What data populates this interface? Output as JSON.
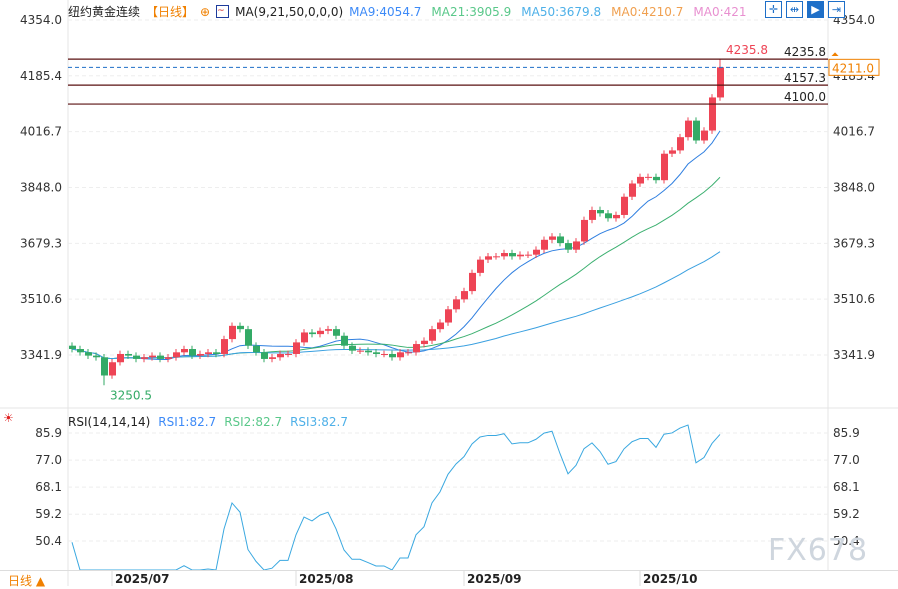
{
  "header": {
    "title": "纽约黄金连续",
    "period_tag": "【日线】",
    "ma_label": "MA(9,21,50,0,0,0)",
    "ma": [
      {
        "label": "MA9:4054.7",
        "color": "#3d8af7"
      },
      {
        "label": "MA21:3905.9",
        "color": "#5ac88a"
      },
      {
        "label": "MA50:3679.8",
        "color": "#4eb0e8"
      },
      {
        "label": "MA0:4210.7",
        "color": "#f0a050"
      },
      {
        "label": "MA0:421",
        "color": "#e890d0"
      }
    ]
  },
  "toolbar": [
    {
      "icon": "crosshair-icon",
      "glyph": "✛"
    },
    {
      "icon": "fit-range-icon",
      "glyph": "⇹"
    },
    {
      "icon": "play-forward-icon",
      "glyph": "▶"
    },
    {
      "icon": "jump-end-icon",
      "glyph": "⇥"
    }
  ],
  "price_axis": {
    "min": 3341.9,
    "max": 4354.0,
    "ticks": [
      "4354.0",
      "4185.4",
      "4016.7",
      "3848.0",
      "3679.3",
      "3510.6",
      "3341.9"
    ]
  },
  "levels": [
    {
      "value": 4235.8,
      "label": "4235.8"
    },
    {
      "value": 4157.3,
      "label": "4157.3"
    },
    {
      "value": 4100.0,
      "label": "4100.0"
    }
  ],
  "current_price": {
    "value": 4211.0,
    "label": "4211.0"
  },
  "high_marker": {
    "value": 4235.8,
    "label": "4235.8"
  },
  "low_marker": {
    "value": 3250.5,
    "label": "3250.5"
  },
  "colors": {
    "up": "#ee4455",
    "down": "#33aa66",
    "level": "#5a1010",
    "current": "#1e6fc8",
    "current_box": "#f08000"
  },
  "closes": [
    3360,
    3350,
    3340,
    3335,
    3280,
    3320,
    3345,
    3340,
    3330,
    3335,
    3340,
    3330,
    3335,
    3350,
    3360,
    3340,
    3345,
    3350,
    3345,
    3390,
    3430,
    3420,
    3370,
    3350,
    3330,
    3335,
    3345,
    3345,
    3380,
    3410,
    3405,
    3415,
    3420,
    3400,
    3370,
    3355,
    3355,
    3350,
    3345,
    3345,
    3335,
    3350,
    3350,
    3375,
    3385,
    3420,
    3440,
    3480,
    3510,
    3535,
    3590,
    3630,
    3640,
    3640,
    3650,
    3640,
    3645,
    3645,
    3660,
    3690,
    3700,
    3680,
    3660,
    3685,
    3750,
    3780,
    3770,
    3755,
    3765,
    3820,
    3860,
    3880,
    3880,
    3870,
    3950,
    3960,
    4000,
    4050,
    3990,
    4020,
    4120,
    4211
  ],
  "dates": [
    {
      "label": "2025/07",
      "index": 5
    },
    {
      "label": "2025/08",
      "index": 28
    },
    {
      "label": "2025/09",
      "index": 49
    },
    {
      "label": "2025/10",
      "index": 71
    }
  ],
  "rsi": {
    "header": "RSI(14,14,14)",
    "items": [
      {
        "label": "RSI1:82.7",
        "color": "#3d8af7"
      },
      {
        "label": "RSI2:82.7",
        "color": "#5ac88a"
      },
      {
        "label": "RSI3:82.7",
        "color": "#4eb0e8"
      }
    ],
    "ticks": [
      "85.9",
      "77.0",
      "68.1",
      "59.2",
      "50.4"
    ],
    "min": 50.4,
    "max": 85.9
  },
  "footer": {
    "period": "日线 ▲"
  },
  "watermark": "FX678"
}
